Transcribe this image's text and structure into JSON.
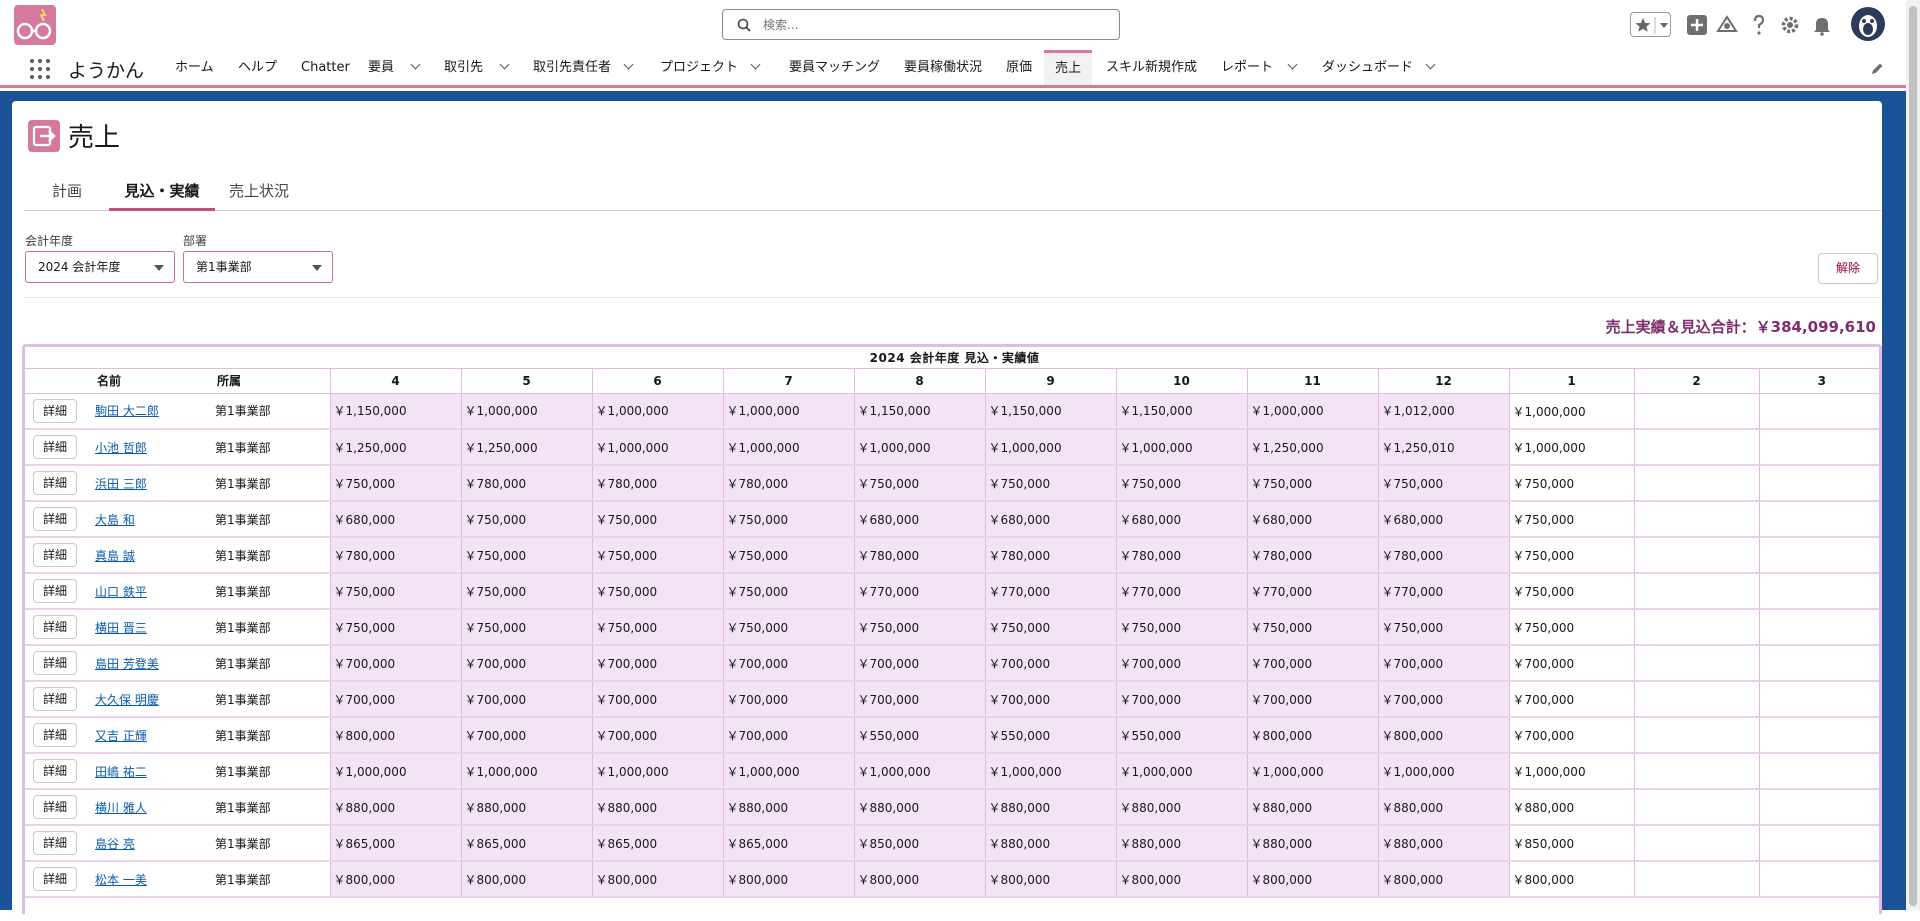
{
  "header": {
    "search_placeholder": "検索...",
    "app_name": "ようかん"
  },
  "nav": [
    {
      "label": "ホーム",
      "chevron": false
    },
    {
      "label": "ヘルプ",
      "chevron": false
    },
    {
      "label": "Chatter",
      "chevron": false
    },
    {
      "label": "要員",
      "chevron": true
    },
    {
      "label": "取引先",
      "chevron": true
    },
    {
      "label": "取引先責任者",
      "chevron": true
    },
    {
      "label": "プロジェクト",
      "chevron": true
    },
    {
      "label": "要員マッチング",
      "chevron": false
    },
    {
      "label": "要員稼働状況",
      "chevron": false
    },
    {
      "label": "原価",
      "chevron": false
    },
    {
      "label": "売上",
      "chevron": false,
      "active": true
    },
    {
      "label": "スキル新規作成",
      "chevron": false
    },
    {
      "label": "レポート",
      "chevron": true
    },
    {
      "label": "ダッシュボード",
      "chevron": true
    }
  ],
  "page": {
    "title": "売上",
    "tabs": [
      {
        "label": "計画",
        "active": false
      },
      {
        "label": "見込・実績",
        "active": true
      },
      {
        "label": "売上状況",
        "active": false
      }
    ]
  },
  "filters": {
    "year_label": "会計年度",
    "year_value": "2024 会計年度",
    "dept_label": "部署",
    "dept_value": "第1事業部",
    "clear_label": "解除"
  },
  "total_text": "売上実績＆見込合計：￥384,099,610",
  "table": {
    "caption": "2024 会計年度 見込・実績値",
    "name_header": "名前",
    "dept_header": "所属",
    "months": [
      "4",
      "5",
      "6",
      "7",
      "8",
      "9",
      "10",
      "11",
      "12",
      "1",
      "2",
      "3"
    ],
    "detail_label": "詳細",
    "rows": [
      {
        "name": "駒田 大二郎",
        "dept": "第1事業部",
        "values": [
          "￥1,150,000",
          "￥1,000,000",
          "￥1,000,000",
          "￥1,000,000",
          "￥1,150,000",
          "￥1,150,000",
          "￥1,150,000",
          "￥1,000,000",
          "￥1,012,000",
          "￥1,000,000",
          "",
          ""
        ]
      },
      {
        "name": "小池 哲郎",
        "dept": "第1事業部",
        "values": [
          "￥1,250,000",
          "￥1,250,000",
          "￥1,000,000",
          "￥1,000,000",
          "￥1,000,000",
          "￥1,000,000",
          "￥1,000,000",
          "￥1,250,000",
          "￥1,250,010",
          "￥1,000,000",
          "",
          ""
        ]
      },
      {
        "name": "浜田 三郎",
        "dept": "第1事業部",
        "values": [
          "￥750,000",
          "￥780,000",
          "￥780,000",
          "￥780,000",
          "￥750,000",
          "￥750,000",
          "￥750,000",
          "￥750,000",
          "￥750,000",
          "￥750,000",
          "",
          ""
        ]
      },
      {
        "name": "大島 和",
        "dept": "第1事業部",
        "values": [
          "￥680,000",
          "￥750,000",
          "￥750,000",
          "￥750,000",
          "￥680,000",
          "￥680,000",
          "￥680,000",
          "￥680,000",
          "￥680,000",
          "￥750,000",
          "",
          ""
        ]
      },
      {
        "name": "真島 誠",
        "dept": "第1事業部",
        "values": [
          "￥780,000",
          "￥750,000",
          "￥750,000",
          "￥750,000",
          "￥780,000",
          "￥780,000",
          "￥780,000",
          "￥780,000",
          "￥780,000",
          "￥750,000",
          "",
          ""
        ]
      },
      {
        "name": "山口 鉄平",
        "dept": "第1事業部",
        "values": [
          "￥750,000",
          "￥750,000",
          "￥750,000",
          "￥750,000",
          "￥770,000",
          "￥770,000",
          "￥770,000",
          "￥770,000",
          "￥770,000",
          "￥750,000",
          "",
          ""
        ]
      },
      {
        "name": "横田 晋三",
        "dept": "第1事業部",
        "values": [
          "￥750,000",
          "￥750,000",
          "￥750,000",
          "￥750,000",
          "￥750,000",
          "￥750,000",
          "￥750,000",
          "￥750,000",
          "￥750,000",
          "￥750,000",
          "",
          ""
        ]
      },
      {
        "name": "島田 芳登美",
        "dept": "第1事業部",
        "values": [
          "￥700,000",
          "￥700,000",
          "￥700,000",
          "￥700,000",
          "￥700,000",
          "￥700,000",
          "￥700,000",
          "￥700,000",
          "￥700,000",
          "￥700,000",
          "",
          ""
        ]
      },
      {
        "name": "大久保 明慶",
        "dept": "第1事業部",
        "values": [
          "￥700,000",
          "￥700,000",
          "￥700,000",
          "￥700,000",
          "￥700,000",
          "￥700,000",
          "￥700,000",
          "￥700,000",
          "￥700,000",
          "￥700,000",
          "",
          ""
        ]
      },
      {
        "name": "又吉 正輝",
        "dept": "第1事業部",
        "values": [
          "￥800,000",
          "￥700,000",
          "￥700,000",
          "￥700,000",
          "￥550,000",
          "￥550,000",
          "￥550,000",
          "￥800,000",
          "￥800,000",
          "￥700,000",
          "",
          ""
        ]
      },
      {
        "name": "田嶋 祐二",
        "dept": "第1事業部",
        "values": [
          "￥1,000,000",
          "￥1,000,000",
          "￥1,000,000",
          "￥1,000,000",
          "￥1,000,000",
          "￥1,000,000",
          "￥1,000,000",
          "￥1,000,000",
          "￥1,000,000",
          "￥1,000,000",
          "",
          ""
        ]
      },
      {
        "name": "横川 雅人",
        "dept": "第1事業部",
        "values": [
          "￥880,000",
          "￥880,000",
          "￥880,000",
          "￥880,000",
          "￥880,000",
          "￥880,000",
          "￥880,000",
          "￥880,000",
          "￥880,000",
          "￥880,000",
          "",
          ""
        ]
      },
      {
        "name": "島谷 亮",
        "dept": "第1事業部",
        "values": [
          "￥865,000",
          "￥865,000",
          "￥865,000",
          "￥865,000",
          "￥850,000",
          "￥880,000",
          "￥880,000",
          "￥880,000",
          "￥880,000",
          "￥850,000",
          "",
          ""
        ]
      },
      {
        "name": "松本 一美",
        "dept": "第1事業部",
        "values": [
          "￥800,000",
          "￥800,000",
          "￥800,000",
          "￥800,000",
          "￥800,000",
          "￥800,000",
          "￥800,000",
          "￥800,000",
          "￥800,000",
          "￥800,000",
          "",
          ""
        ]
      }
    ]
  },
  "colors": {
    "accent": "#d5799e",
    "month_cell_bg": "#f2e4f4",
    "total_text": "#7d2f6c",
    "link": "#0b5cab"
  },
  "icons": [
    "app-logo-icon",
    "search-icon",
    "favorites-star-icon",
    "add-icon",
    "trailhead-icon",
    "help-icon",
    "gear-icon",
    "bell-icon",
    "user-avatar",
    "app-launcher-icon",
    "pencil-icon",
    "sales-icon"
  ]
}
